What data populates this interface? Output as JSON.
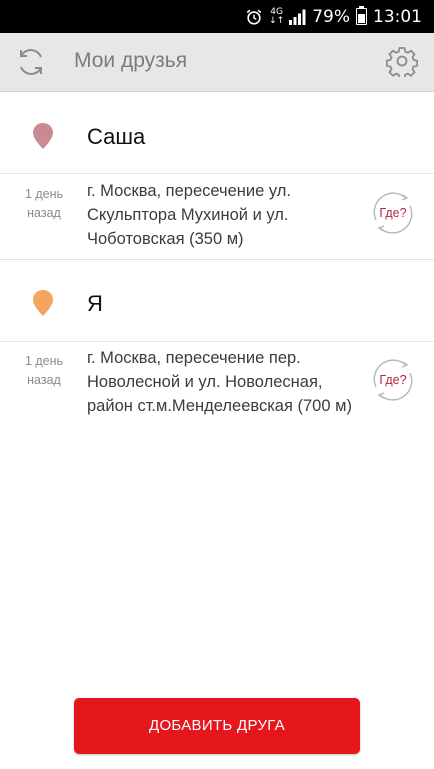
{
  "status_bar": {
    "network": "4G",
    "network_sub": "↓↑",
    "battery_percent": "79%",
    "time": "13:01",
    "battery_level": 0.79
  },
  "toolbar": {
    "title": "Мои друзья",
    "refresh_icon": "refresh-icon",
    "settings_icon": "gear-icon"
  },
  "friends": [
    {
      "name": "Саша",
      "pin_color": "#c98a94",
      "time_line1": "1 день",
      "time_line2": "назад",
      "address": "г. Москва, пересечение ул. Скульптора Мухиной и ул. Чоботовская (350 м)",
      "where_label": "Где?"
    },
    {
      "name": "Я",
      "pin_color": "#f3a45d",
      "time_line1": "1 день",
      "time_line2": "назад",
      "address": "г. Москва, пересечение пер. Новолесной и ул. Новолесная, район ст.м.Менделеевская (700 м)",
      "where_label": "Где?"
    }
  ],
  "add_button": {
    "label": "ДОБАВИТЬ ДРУГА"
  },
  "colors": {
    "accent": "#e5171c",
    "toolbar_bg": "#e9e6e8",
    "where_text": "#b0283c"
  }
}
